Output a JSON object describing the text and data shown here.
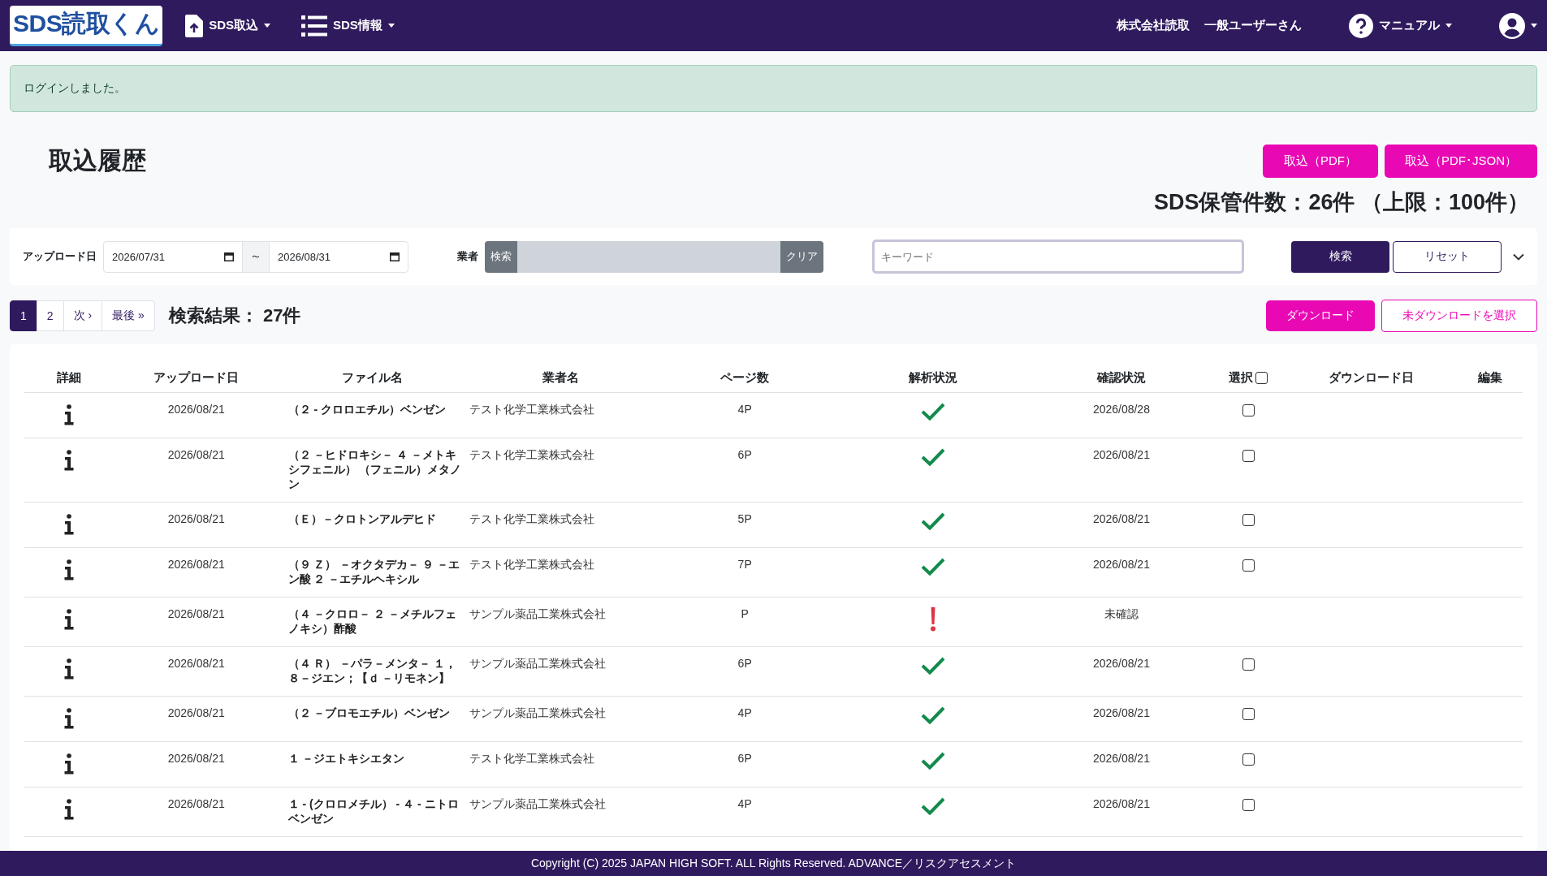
{
  "navbar": {
    "logo": "SDS読取くん",
    "menus": [
      {
        "label": "SDS取込",
        "kind": "upload"
      },
      {
        "label": "SDS情報",
        "kind": "list"
      }
    ],
    "company": "株式会社読取",
    "user": "一般ユーザーさん",
    "manual": "マニュアル"
  },
  "alert": "ログインしました。",
  "page_title": "取込履歴",
  "import_buttons": [
    "取込（PDF）",
    "取込（PDF･JSON）"
  ],
  "storage_count": "SDS保管件数：26件 （上限：100件）",
  "filter": {
    "date_label": "アップロード日",
    "date_from": "2026/07/31",
    "date_sep": "～",
    "date_to": "2026/08/31",
    "vendor_label": "業者",
    "vendor_search": "検索",
    "vendor_clear": "クリア",
    "keyword_placeholder": "キーワード",
    "search": "検索",
    "reset": "リセット"
  },
  "pagination": [
    {
      "label": "1",
      "selected": true
    },
    {
      "label": "2",
      "selected": false
    },
    {
      "label": "次 ›",
      "selected": false
    },
    {
      "label": "最後 »",
      "selected": false
    }
  ],
  "result_count": "検索結果： 27件",
  "download_button": "ダウンロード",
  "select_undownloaded": "未ダウンロードを選択",
  "table": {
    "columns": [
      "詳細",
      "アップロード日",
      "ファイル名",
      "業者名",
      "ページ数",
      "解析状況",
      "確認状況",
      "選択",
      "ダウンロード日",
      "編集"
    ],
    "select_all_checked": false,
    "rows": [
      {
        "upload_date": "2026/08/21",
        "file_name": "（２ - クロロエチル）ベンゼン",
        "vendor": "テスト化学工業株式会社",
        "pages": "4P",
        "kind": "ok",
        "confirmed": "2026/08/28",
        "checked": false
      },
      {
        "upload_date": "2026/08/21",
        "file_name": "（２ －ヒドロキシ－ ４ －メトキシフェニル） （フェニル）メタノン",
        "vendor": "テスト化学工業株式会社",
        "pages": "6P",
        "kind": "ok",
        "confirmed": "2026/08/21",
        "checked": false
      },
      {
        "upload_date": "2026/08/21",
        "file_name": "（Ｅ）－クロトンアルデヒド",
        "vendor": "テスト化学工業株式会社",
        "pages": "5P",
        "kind": "ok",
        "confirmed": "2026/08/21",
        "checked": false
      },
      {
        "upload_date": "2026/08/21",
        "file_name": "（９ Ｚ） －オクタデカ－ ９ －エン酸 ２ －エチルヘキシル",
        "vendor": "テスト化学工業株式会社",
        "pages": "7P",
        "kind": "ok",
        "confirmed": "2026/08/21",
        "checked": false
      },
      {
        "upload_date": "2026/08/21",
        "file_name": "（４ －クロロ－ ２ －メチルフェノキシ）酢酸",
        "vendor": "サンプル薬品工業株式会社",
        "pages": "P",
        "kind": "warn",
        "confirmed": "未確認"
      },
      {
        "upload_date": "2026/08/21",
        "file_name": "（４ Ｒ） －パラ－メンタ－ １，８－ジエン；【ｄ －リモネン】",
        "vendor": "サンプル薬品工業株式会社",
        "pages": "6P",
        "kind": "ok",
        "confirmed": "2026/08/21",
        "checked": false
      },
      {
        "upload_date": "2026/08/21",
        "file_name": "（２ －ブロモエチル）ベンゼン",
        "vendor": "サンプル薬品工業株式会社",
        "pages": "4P",
        "kind": "ok",
        "confirmed": "2026/08/21",
        "checked": false
      },
      {
        "upload_date": "2026/08/21",
        "file_name": "１ －ジエトキシエタン",
        "vendor": "テスト化学工業株式会社",
        "pages": "6P",
        "kind": "ok",
        "confirmed": "2026/08/21",
        "checked": false
      },
      {
        "upload_date": "2026/08/21",
        "file_name": "１ - (クロロメチル） - ４ - ニトロベンゼン",
        "vendor": "サンプル薬品工業株式会社",
        "pages": "4P",
        "kind": "ok",
        "confirmed": "2026/08/21",
        "checked": false
      }
    ]
  },
  "footer": "Copyright (C) 2025 JAPAN HIGH SOFT. ALL Rights Reserved. ADVANCE／リスクアセスメント"
}
